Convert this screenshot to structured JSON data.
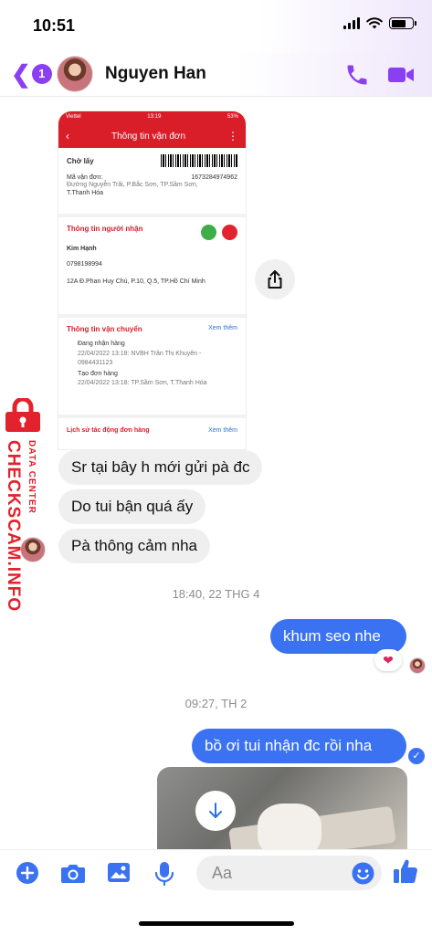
{
  "status_bar": {
    "time": "10:51"
  },
  "header": {
    "back_badge": "1",
    "contact_name": "Nguyen Han"
  },
  "shared_screenshot": {
    "carrier": "Viettel",
    "phone_time": "13:19",
    "battery": "53%",
    "title": "Thông tin vận đơn",
    "status_label": "Chờ lấy",
    "tracking_label": "Mã vận đơn:",
    "tracking_number": "1673284974962",
    "sender_address": "Đường Nguyễn Trãi, P.Bắc Sơn, TP.Sầm Sơn,",
    "sender_province": "T.Thanh Hóa",
    "recipient_section": "Thông tin người nhận",
    "recipient_name": "Kim Hạnh",
    "recipient_phone": "0798198994",
    "recipient_address": "12A Đ.Phan Huy Chú, P.10, Q.5, TP.Hồ Chí Minh",
    "shipping_section": "Thông tin vận chuyển",
    "see_more": "Xem thêm",
    "event1_title": "Đang nhận hàng",
    "event1_detail": "22/04/2022 13:18: NVBH Trần Thị Khuyên - 0984431123",
    "event2_title": "Tạo đơn hàng",
    "event2_detail": "22/04/2022 13:18: TP.Sầm Sơn, T.Thanh Hóa",
    "history_section": "Lịch sử tác động đơn hàng",
    "history_see_more": "Xem thêm"
  },
  "messages": {
    "in1": "Sr tại bây h mới gửi pà đc",
    "in2": "Do tui bận quá ấy",
    "in3": "Pà thông cảm nha",
    "time1": "18:40, 22 THG 4",
    "out1": "khum seo nhe",
    "time2": "09:27, TH 2",
    "out2": "bồ ơi tui nhận đc rồi nha"
  },
  "watermark": {
    "data_center": "DATA CENTER",
    "site": "CHECKSCAM.INFO"
  },
  "composer": {
    "placeholder": "Aa"
  },
  "colors": {
    "accent": "#8b3ff3",
    "outgoing": "#3b72f2",
    "incoming": "#efefef",
    "watermark": "#e2222c"
  }
}
